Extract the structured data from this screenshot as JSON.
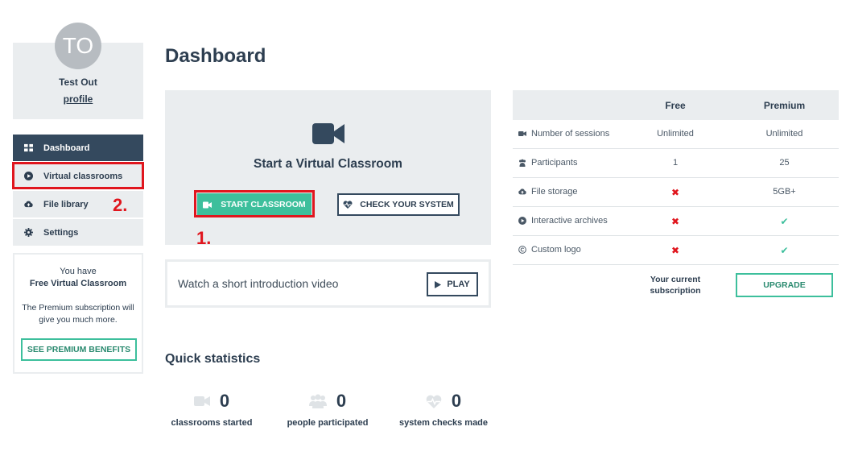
{
  "profile": {
    "initials": "TO",
    "name": "Test Out",
    "link": "profile"
  },
  "sidebar": {
    "items": [
      {
        "label": "Dashboard",
        "icon": "grid-icon",
        "active": true
      },
      {
        "label": "Virtual classrooms",
        "icon": "play-circle-icon"
      },
      {
        "label": "File library",
        "icon": "cloud-upload-icon"
      },
      {
        "label": "Settings",
        "icon": "gear-icon"
      }
    ]
  },
  "promo": {
    "line1": "You have",
    "line2": "Free Virtual Classroom",
    "text": "The Premium subscription will give you much more.",
    "button": "SEE PREMIUM BENEFITS"
  },
  "annotations": {
    "step1": "1.",
    "step2": "2.",
    "color": "#e0161e"
  },
  "main": {
    "title": "Dashboard",
    "start": {
      "title": "Start a Virtual Classroom",
      "start_button": "START CLASSROOM",
      "check_button": "CHECK YOUR SYSTEM"
    },
    "video": {
      "text": "Watch a short introduction video",
      "play_button": "PLAY"
    },
    "stats": {
      "title": "Quick statistics",
      "items": [
        {
          "value": "0",
          "label": "classrooms started",
          "icon": "video-camera-icon"
        },
        {
          "value": "0",
          "label": "people participated",
          "icon": "users-icon"
        },
        {
          "value": "0",
          "label": "system checks made",
          "icon": "heart-pulse-icon"
        }
      ]
    }
  },
  "pricing": {
    "headers": {
      "free": "Free",
      "premium": "Premium"
    },
    "rows": [
      {
        "feature": "Number of sessions",
        "icon": "video-camera-icon",
        "free": "Unlimited",
        "premium": "Unlimited"
      },
      {
        "feature": "Participants",
        "icon": "users-icon",
        "free": "1",
        "premium": "25"
      },
      {
        "feature": "File storage",
        "icon": "cloud-upload-icon",
        "free": "✖",
        "premium": "5GB+"
      },
      {
        "feature": "Interactive archives",
        "icon": "play-circle-icon",
        "free": "✖",
        "premium": "✔"
      },
      {
        "feature": "Custom logo",
        "icon": "copyright-icon",
        "free": "✖",
        "premium": "✔"
      }
    ],
    "subscription_label": "Your current subscription",
    "upgrade_button": "UPGRADE"
  },
  "colors": {
    "accent": "#3dbf9c",
    "navy": "#34495e",
    "panel": "#eaedef",
    "error": "#e0161e"
  }
}
